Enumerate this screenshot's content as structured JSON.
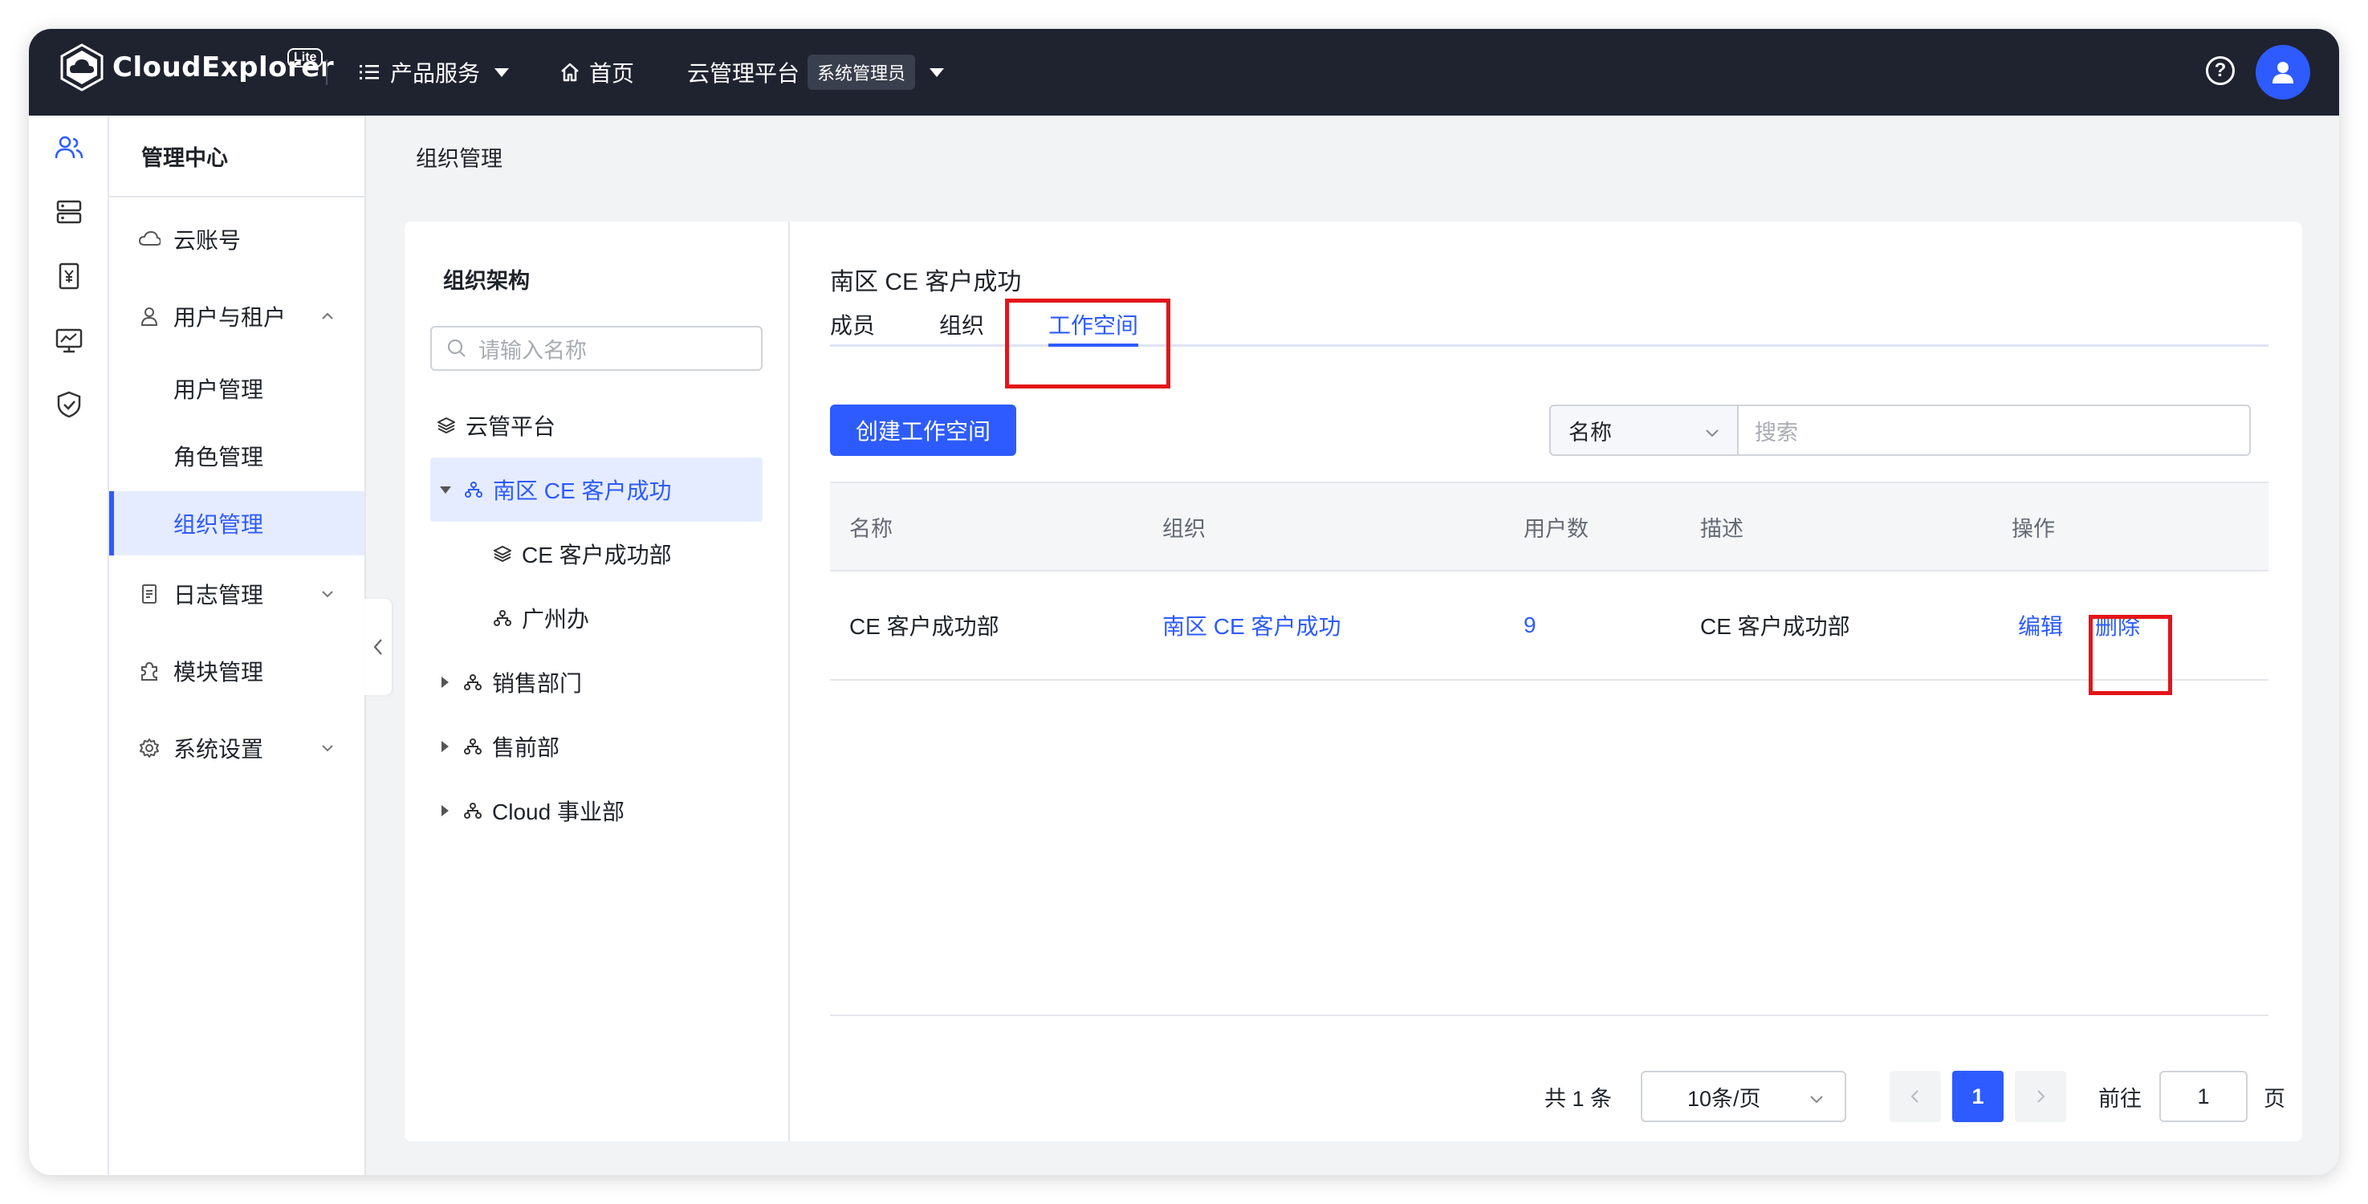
{
  "app": {
    "logo_text": "CloudExplorer",
    "edition": "Lite"
  },
  "topbar": {
    "products_label": "产品服务",
    "home_label": "首页",
    "platform_label": "云管理平台",
    "role_badge": "系统管理员"
  },
  "sidebar": {
    "header": "管理中心",
    "items": [
      {
        "label": "云账号",
        "icon": "cloud-icon"
      },
      {
        "label": "用户与租户",
        "icon": "user-icon",
        "expanded": true
      },
      {
        "label": "用户管理"
      },
      {
        "label": "角色管理"
      },
      {
        "label": "组织管理",
        "active": true
      },
      {
        "label": "日志管理",
        "icon": "document-icon"
      },
      {
        "label": "模块管理",
        "icon": "puzzle-icon"
      },
      {
        "label": "系统设置",
        "icon": "gear-icon"
      }
    ]
  },
  "page": {
    "title": "组织管理"
  },
  "tree": {
    "title": "组织架构",
    "search_placeholder": "请输入名称",
    "nodes": [
      {
        "label": "云管平台",
        "icon": "layers-icon",
        "level": 0
      },
      {
        "label": "南区 CE 客户成功",
        "icon": "org-icon",
        "level": 1,
        "expanded": true,
        "active": true
      },
      {
        "label": "CE 客户成功部",
        "icon": "layers-icon",
        "level": 2
      },
      {
        "label": "广州办",
        "icon": "org-icon",
        "level": 2
      },
      {
        "label": "销售部门",
        "icon": "org-icon",
        "level": 1
      },
      {
        "label": "售前部",
        "icon": "org-icon",
        "level": 1
      },
      {
        "label": "Cloud 事业部",
        "icon": "org-icon",
        "level": 1
      }
    ]
  },
  "detail": {
    "title": "南区 CE 客户成功",
    "tabs": [
      {
        "label": "成员"
      },
      {
        "label": "组织"
      },
      {
        "label": "工作空间",
        "active": true
      }
    ],
    "create_button": "创建工作空间",
    "filter_field": "名称",
    "search_placeholder": "搜索",
    "table": {
      "columns": [
        "名称",
        "组织",
        "用户数",
        "描述",
        "操作"
      ],
      "rows": [
        {
          "name": "CE 客户成功部",
          "org": "南区 CE 客户成功",
          "users": "9",
          "desc": "CE 客户成功部",
          "edit": "编辑",
          "delete": "删除"
        }
      ]
    },
    "pagination": {
      "total_text": "共 1 条",
      "page_size": "10条/页",
      "current_page": "1",
      "goto_label": "前往",
      "goto_value": "1",
      "page_unit": "页"
    }
  },
  "colors": {
    "accent": "#2d5bff",
    "topbar": "#1f2330",
    "highlight": "#e3151a"
  }
}
